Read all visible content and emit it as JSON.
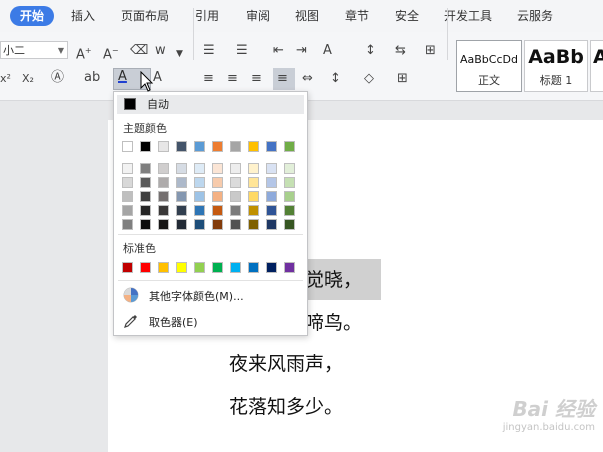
{
  "menubar": {
    "items": [
      "开始",
      "插入",
      "页面布局",
      "引用",
      "审阅",
      "视图",
      "章节",
      "安全",
      "开发工具",
      "云服务"
    ]
  },
  "ribbon": {
    "font_size_value": "小二",
    "styles": [
      {
        "preview": "AaBbCcDd",
        "name": "正文"
      },
      {
        "preview": "AaBb",
        "name": "标题 1"
      },
      {
        "preview": "A",
        "name": ""
      }
    ]
  },
  "color_menu": {
    "auto_label": "自动",
    "theme_title": "主题颜色",
    "theme_top_row": [
      "#ffffff",
      "#000000",
      "#e7e6e6",
      "#44546a",
      "#5b9bd5",
      "#ed7d31",
      "#a5a5a5",
      "#ffc000",
      "#4472c4",
      "#70ad47"
    ],
    "theme_shades": [
      [
        "#f2f2f2",
        "#7f7f7f",
        "#d0cece",
        "#d6dce4",
        "#deebf6",
        "#fbe5d5",
        "#ededed",
        "#fff2cc",
        "#d9e2f3",
        "#e2efd9"
      ],
      [
        "#d8d8d8",
        "#595959",
        "#aeabab",
        "#adb9ca",
        "#bdd7ee",
        "#f7cbac",
        "#dbdbdb",
        "#ffe598",
        "#b4c6e7",
        "#c5e0b3"
      ],
      [
        "#bfbfbf",
        "#3f3f3f",
        "#757070",
        "#8497b0",
        "#9dc3e6",
        "#f4b183",
        "#c9c9c9",
        "#ffd965",
        "#8eaadb",
        "#a8d08d"
      ],
      [
        "#a5a5a5",
        "#262626",
        "#3a3838",
        "#323f4f",
        "#2e75b5",
        "#c55a11",
        "#7b7b7b",
        "#bf9000",
        "#2f5496",
        "#538135"
      ],
      [
        "#7f7f7f",
        "#0c0c0c",
        "#171616",
        "#222a35",
        "#1e4e79",
        "#833c0b",
        "#525252",
        "#7f6000",
        "#1f3864",
        "#375623"
      ]
    ],
    "standard_title": "标准色",
    "standard_colors": [
      "#c00000",
      "#ff0000",
      "#ffc000",
      "#ffff00",
      "#92d050",
      "#00b050",
      "#00b0f0",
      "#0070c0",
      "#002060",
      "#7030a0"
    ],
    "more_colors_label": "其他字体颜色(M)...",
    "eyedropper_label": "取色器(E)",
    "icons": [
      "palette-icon",
      "eyedropper-icon"
    ]
  },
  "document": {
    "lines": [
      "觉晓，",
      "啼鸟。",
      "夜来风雨声，",
      "花落知多少。"
    ]
  },
  "watermark": {
    "brand": "Bai 经验",
    "url": "jingyan.baidu.com"
  }
}
